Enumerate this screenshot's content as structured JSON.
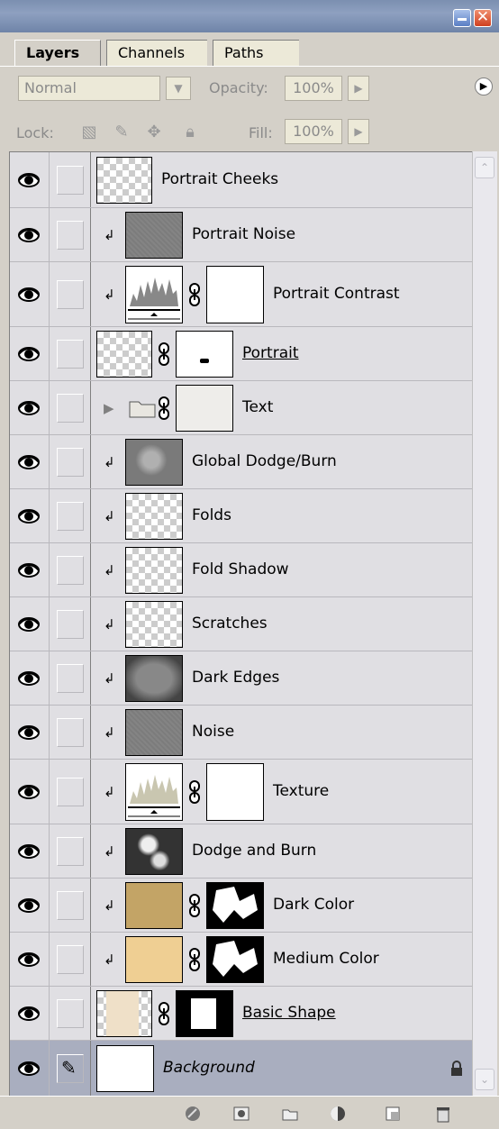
{
  "tabs": [
    "Layers",
    "Channels",
    "Paths"
  ],
  "blend": {
    "mode": "Normal",
    "opacity_label": "Opacity:",
    "opacity_value": "100%"
  },
  "lock": {
    "label": "Lock:",
    "fill_label": "Fill:",
    "fill_value": "100%"
  },
  "layers": [
    {
      "name": "Portrait Cheeks",
      "clipped": false,
      "thumb": "checker",
      "mask": null,
      "style": ""
    },
    {
      "name": "Portrait Noise",
      "clipped": true,
      "thumb": "noise",
      "mask": null,
      "style": ""
    },
    {
      "name": "Portrait Contrast",
      "clipped": true,
      "thumb": "levels-adjustment",
      "mask": "white",
      "style": ""
    },
    {
      "name": "Portrait",
      "clipped": false,
      "thumb": "checker",
      "mask": "white",
      "style": "underline"
    },
    {
      "name": "Text",
      "clipped": false,
      "thumb": "folder",
      "mask": "light",
      "style": ""
    },
    {
      "name": "Global Dodge/Burn",
      "clipped": true,
      "thumb": "gray-blotch",
      "mask": null,
      "style": ""
    },
    {
      "name": "Folds",
      "clipped": true,
      "thumb": "checker",
      "mask": null,
      "style": ""
    },
    {
      "name": "Fold Shadow",
      "clipped": true,
      "thumb": "checker",
      "mask": null,
      "style": ""
    },
    {
      "name": "Scratches",
      "clipped": true,
      "thumb": "checker",
      "mask": null,
      "style": ""
    },
    {
      "name": "Dark Edges",
      "clipped": true,
      "thumb": "dark-edges",
      "mask": null,
      "style": ""
    },
    {
      "name": "Noise",
      "clipped": true,
      "thumb": "noise",
      "mask": null,
      "style": ""
    },
    {
      "name": "Texture",
      "clipped": true,
      "thumb": "levels-adjustment",
      "mask": "white",
      "style": ""
    },
    {
      "name": "Dodge and Burn",
      "clipped": true,
      "thumb": "dodge-burn",
      "mask": null,
      "style": ""
    },
    {
      "name": "Dark Color",
      "clipped": true,
      "thumb": "tan",
      "mask": "black-white",
      "style": ""
    },
    {
      "name": "Medium Color",
      "clipped": true,
      "thumb": "light-tan",
      "mask": "black-white",
      "style": ""
    },
    {
      "name": "Basic Shape",
      "clipped": false,
      "thumb": "checker-beige",
      "mask": "black-square",
      "style": "underline"
    },
    {
      "name": "Background",
      "clipped": false,
      "thumb": "white",
      "mask": null,
      "style": "italic",
      "locked": true,
      "selected": true
    }
  ],
  "colors": {
    "panel": "#d4d0c8",
    "list": "#e0dfe3",
    "selected": "#a9aebf",
    "tan": "#c3a466",
    "light_tan": "#efcf93"
  },
  "icons": [
    "eye-icon",
    "clip-arrow-icon",
    "chain-link-icon",
    "folder-icon",
    "expand-triangle-icon",
    "lock-icon",
    "brush-icon",
    "layer-style-icon",
    "mask-icon",
    "new-group-icon",
    "adjustment-layer-icon",
    "new-layer-icon",
    "trash-icon"
  ]
}
